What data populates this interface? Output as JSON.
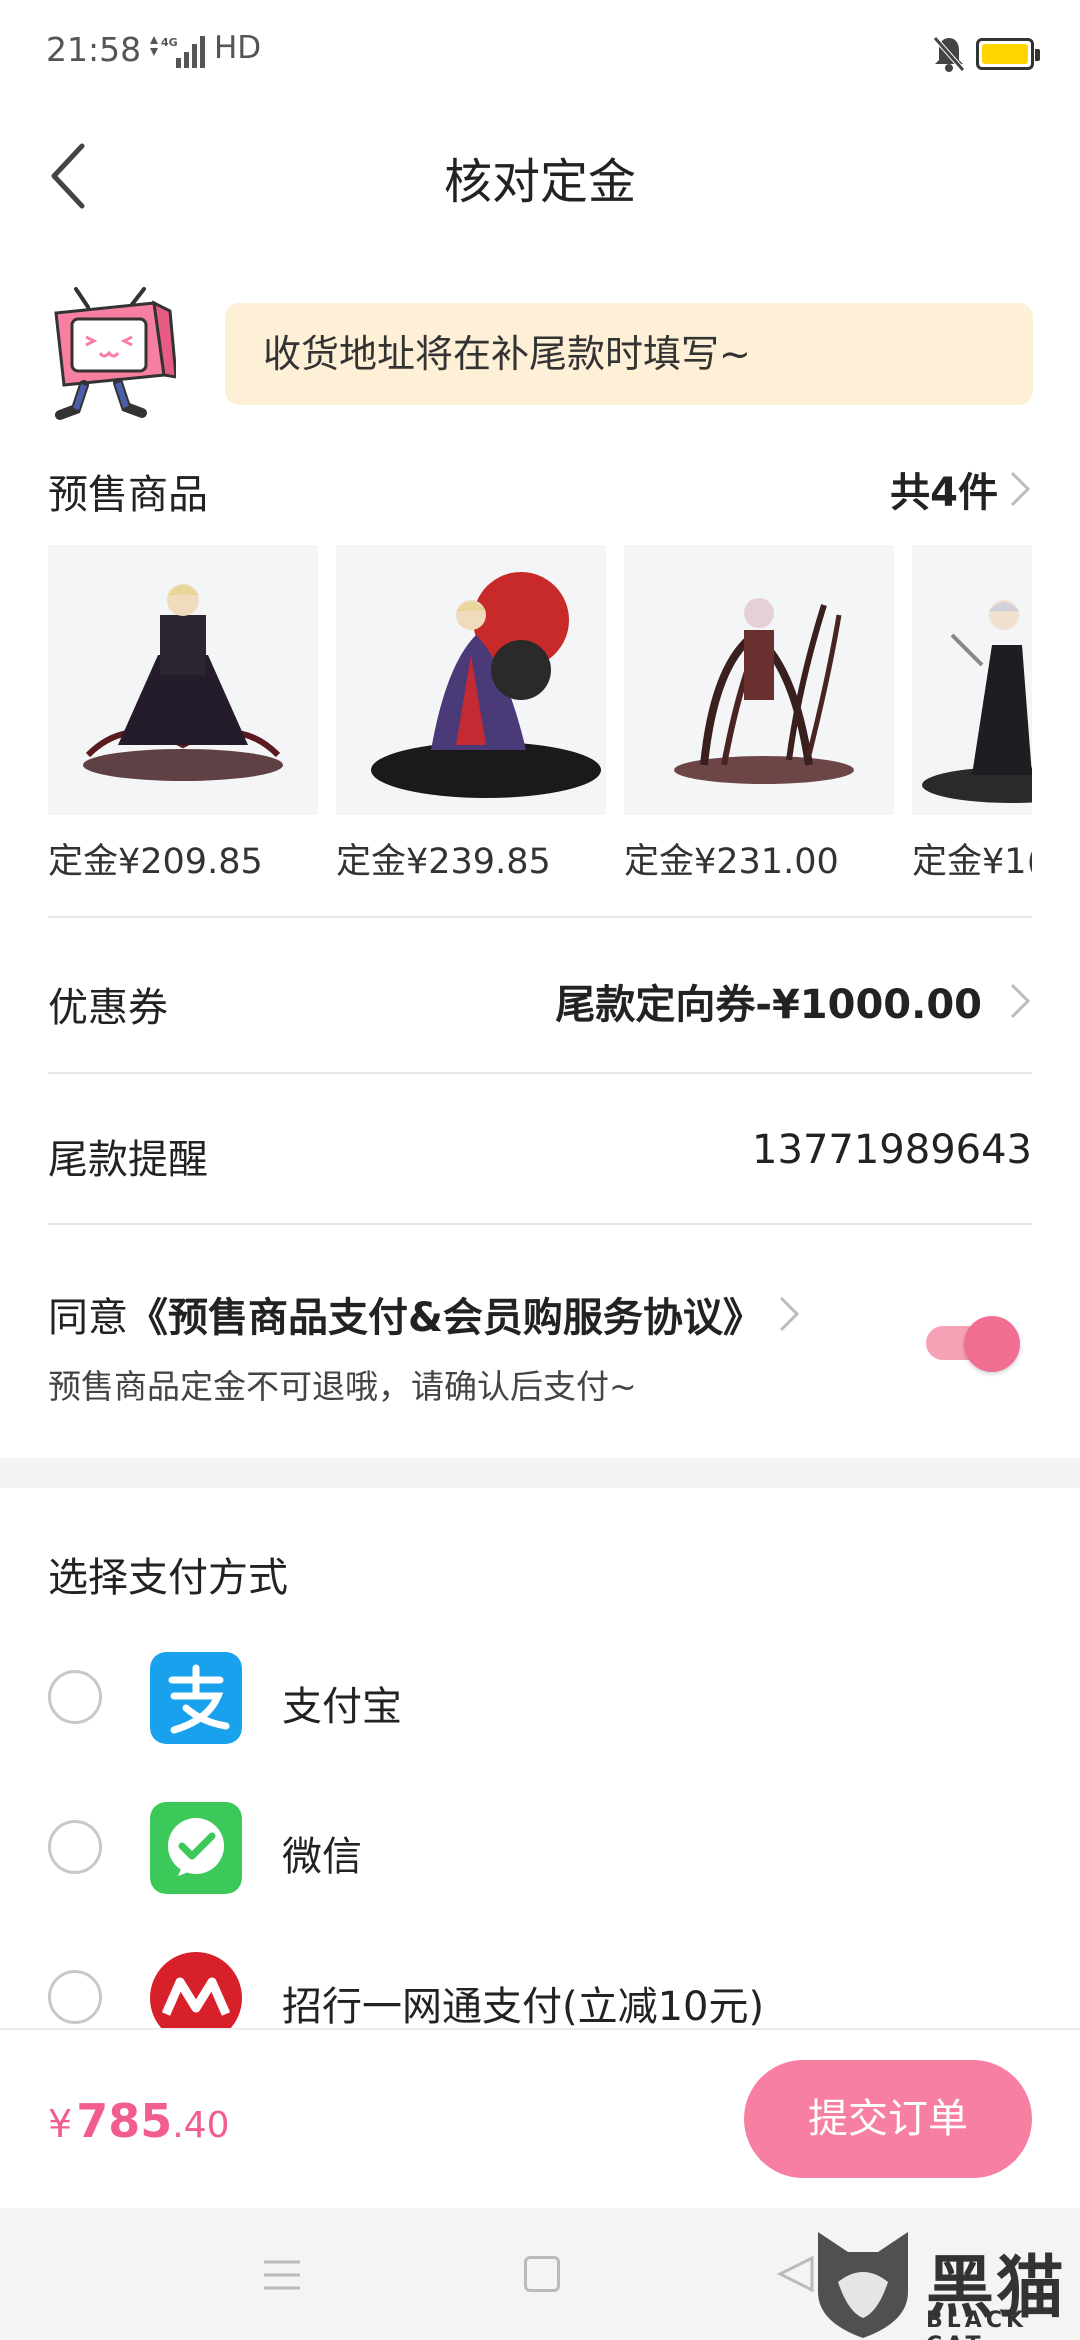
{
  "status_bar": {
    "time": "21:58",
    "network": "4G",
    "hd": "HD"
  },
  "header": {
    "title": "核对定金"
  },
  "notice": {
    "text": "收货地址将在补尾款时填写~"
  },
  "products": {
    "label": "预售商品",
    "count": "共4件",
    "items": [
      {
        "price": "定金¥209.85"
      },
      {
        "price": "定金¥239.85"
      },
      {
        "price": "定金¥231.00"
      },
      {
        "price": "定金¥1("
      }
    ]
  },
  "coupon": {
    "label": "优惠券",
    "value": "尾款定向券-¥1000.00"
  },
  "reminder": {
    "label": "尾款提醒",
    "phone": "13771989643"
  },
  "agreement": {
    "prefix": "同意",
    "link": "《预售商品支付&会员购服务协议》",
    "note": "预售商品定金不可退哦，请确认后支付~",
    "toggle_on": true
  },
  "payment": {
    "title": "选择支付方式",
    "options": [
      {
        "label": "支付宝",
        "icon": "alipay-icon",
        "color": "#1aa1ee"
      },
      {
        "label": "微信",
        "icon": "wechat-icon",
        "color": "#3dc85a"
      },
      {
        "label": "招行一网通支付(立减10元)",
        "icon": "cmb-icon",
        "color": "#d8202a"
      }
    ]
  },
  "footer": {
    "currency": "¥",
    "total_int": "785",
    "total_dec": ".40",
    "submit_label": "提交订单"
  },
  "watermark": {
    "big": "黑猫",
    "small": "BLACK CAT"
  },
  "colors": {
    "accent": "#f25d8e",
    "button": "#f77fa2",
    "notice_bg": "#fdf0d7"
  }
}
